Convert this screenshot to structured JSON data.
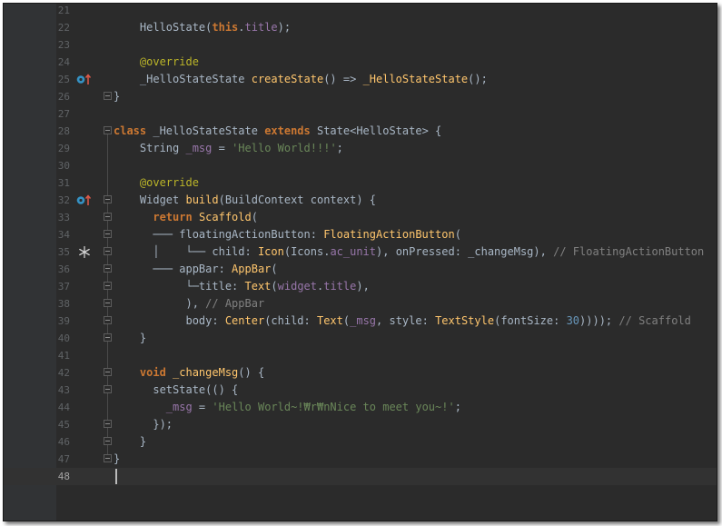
{
  "editor": {
    "lines": [
      {
        "num": "21",
        "segs": []
      },
      {
        "num": "22",
        "segs": [
          [
            "    HelloState(",
            "t"
          ],
          [
            "this",
            "k"
          ],
          [
            ".",
            "t"
          ],
          [
            "title",
            "f"
          ],
          [
            ");",
            "t"
          ]
        ]
      },
      {
        "num": "23",
        "segs": []
      },
      {
        "num": "24",
        "segs": [
          [
            "    ",
            "t"
          ],
          [
            "@override",
            "an"
          ]
        ]
      },
      {
        "num": "25",
        "segs": [
          [
            "    _HelloStateState ",
            "t"
          ],
          [
            "createState",
            "fn"
          ],
          [
            "() => ",
            "t"
          ],
          [
            "_HelloStateState",
            "fn"
          ],
          [
            "();",
            "t"
          ]
        ],
        "icon": "override-up-icon"
      },
      {
        "num": "26",
        "segs": [
          [
            "}",
            "t"
          ]
        ],
        "fold": true
      },
      {
        "num": "27",
        "segs": []
      },
      {
        "num": "28",
        "segs": [
          [
            "class ",
            "k"
          ],
          [
            "_HelloStateState ",
            "t"
          ],
          [
            "extends ",
            "k"
          ],
          [
            "State<HelloState> {",
            "t"
          ]
        ],
        "fold": true
      },
      {
        "num": "29",
        "segs": [
          [
            "    String ",
            "t"
          ],
          [
            "_msg",
            "f"
          ],
          [
            " = ",
            "t"
          ],
          [
            "'Hello World!!!'",
            "s"
          ],
          [
            ";",
            "t"
          ]
        ]
      },
      {
        "num": "30",
        "segs": []
      },
      {
        "num": "31",
        "segs": [
          [
            "    ",
            "t"
          ],
          [
            "@override",
            "an"
          ]
        ]
      },
      {
        "num": "32",
        "segs": [
          [
            "    Widget ",
            "t"
          ],
          [
            "build",
            "fn"
          ],
          [
            "(BuildContext context) {",
            "t"
          ]
        ],
        "fold": true,
        "icon": "override-up-icon"
      },
      {
        "num": "33",
        "segs": [
          [
            "      ",
            "t"
          ],
          [
            "return ",
            "k"
          ],
          [
            "Scaffold",
            "fn"
          ],
          [
            "(",
            "t"
          ]
        ],
        "fold": true
      },
      {
        "num": "34",
        "segs": [
          [
            "      ─── floatingActionButton: ",
            "t"
          ],
          [
            "FloatingActionButton",
            "fn"
          ],
          [
            "(",
            "t"
          ]
        ],
        "fold": true
      },
      {
        "num": "35",
        "segs": [
          [
            "      │    └── child: ",
            "t"
          ],
          [
            "Icon",
            "fn"
          ],
          [
            "(Icons.",
            "t"
          ],
          [
            "ac_unit",
            "f"
          ],
          [
            "), onPressed: _changeMsg), ",
            "t"
          ],
          [
            "// FloatingActionButton",
            "cm"
          ]
        ],
        "fold": true,
        "icon": "snowflake-icon"
      },
      {
        "num": "36",
        "segs": [
          [
            "      ─── appBar: ",
            "t"
          ],
          [
            "AppBar",
            "fn"
          ],
          [
            "(",
            "t"
          ]
        ],
        "fold": true
      },
      {
        "num": "37",
        "segs": [
          [
            "           └─title: ",
            "t"
          ],
          [
            "Text",
            "fn"
          ],
          [
            "(",
            "t"
          ],
          [
            "widget",
            "f"
          ],
          [
            ".",
            "t"
          ],
          [
            "title",
            "f"
          ],
          [
            "),",
            "t"
          ]
        ],
        "fold": true
      },
      {
        "num": "38",
        "segs": [
          [
            "           ), ",
            "t"
          ],
          [
            "// AppBar",
            "cm"
          ]
        ],
        "fold": true
      },
      {
        "num": "39",
        "segs": [
          [
            "           body: ",
            "t"
          ],
          [
            "Center",
            "fn"
          ],
          [
            "(child: ",
            "t"
          ],
          [
            "Text",
            "fn"
          ],
          [
            "(",
            "t"
          ],
          [
            "_msg",
            "f"
          ],
          [
            ", style: ",
            "t"
          ],
          [
            "TextStyle",
            "fn"
          ],
          [
            "(fontSize: ",
            "t"
          ],
          [
            "30",
            "n"
          ],
          [
            ")))); ",
            "t"
          ],
          [
            "// Scaffold",
            "cm"
          ]
        ],
        "fold": true
      },
      {
        "num": "40",
        "segs": [
          [
            "    }",
            "t"
          ]
        ],
        "fold": true
      },
      {
        "num": "41",
        "segs": []
      },
      {
        "num": "42",
        "segs": [
          [
            "    ",
            "t"
          ],
          [
            "void ",
            "k"
          ],
          [
            "_changeMsg",
            "fn"
          ],
          [
            "() {",
            "t"
          ]
        ],
        "fold": true
      },
      {
        "num": "43",
        "segs": [
          [
            "      setState(() {",
            "t"
          ]
        ],
        "fold": true
      },
      {
        "num": "44",
        "segs": [
          [
            "        ",
            "t"
          ],
          [
            "_msg",
            "f"
          ],
          [
            " = ",
            "t"
          ],
          [
            "'Hello World~!₩r₩nNice to meet you~!'",
            "s"
          ],
          [
            ";",
            "t"
          ]
        ]
      },
      {
        "num": "45",
        "segs": [
          [
            "      });",
            "t"
          ]
        ],
        "fold": true
      },
      {
        "num": "46",
        "segs": [
          [
            "    }",
            "t"
          ]
        ],
        "fold": true
      },
      {
        "num": "47",
        "segs": [
          [
            "}",
            "t"
          ]
        ],
        "fold": true
      },
      {
        "num": "48",
        "segs": [],
        "current": true
      }
    ]
  }
}
